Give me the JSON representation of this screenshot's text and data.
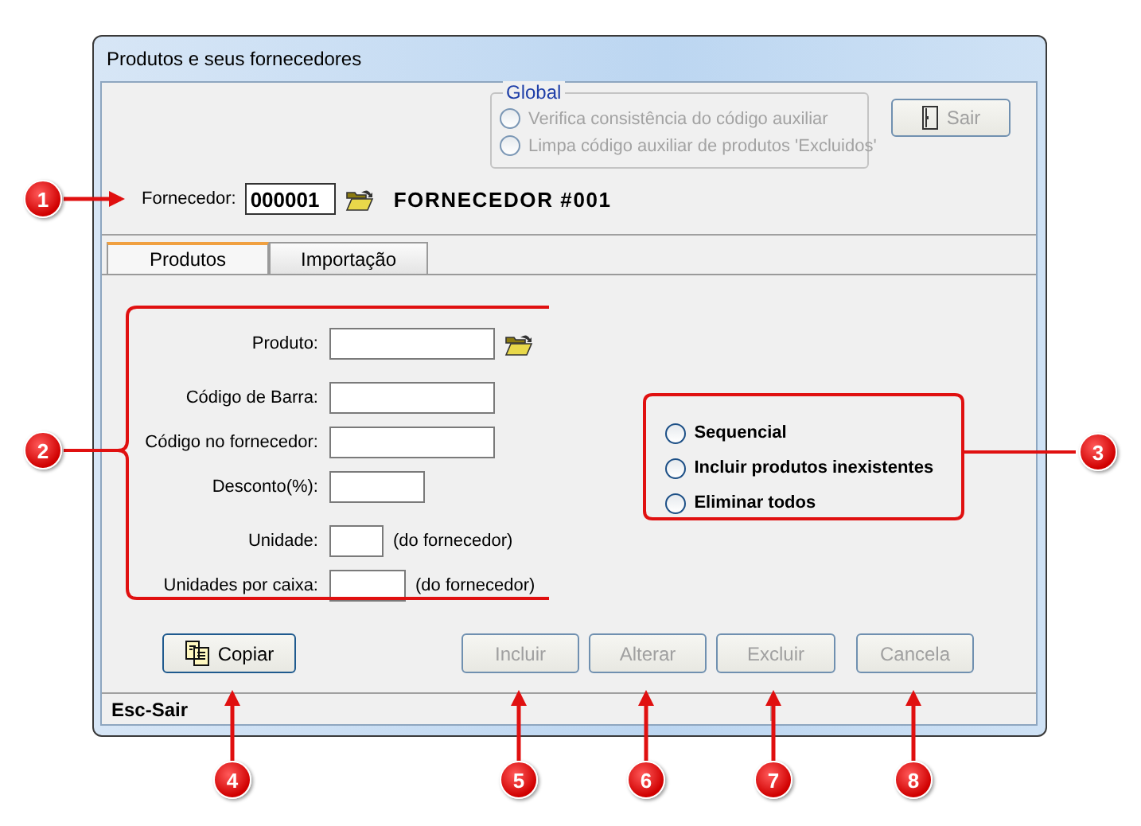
{
  "window": {
    "title": "Produtos e seus fornecedores"
  },
  "global_group": {
    "title": "Global",
    "options": [
      {
        "label": "Verifica consistência do código auxiliar",
        "selected": false,
        "disabled": true
      },
      {
        "label": "Limpa código auxiliar de produtos 'Excluidos'",
        "selected": false,
        "disabled": true
      }
    ]
  },
  "exit_button": {
    "label": "Sair",
    "disabled": true
  },
  "supplier": {
    "label": "Fornecedor:",
    "code": "000001",
    "name": "FORNECEDOR #001"
  },
  "tabs": [
    {
      "label": "Produtos",
      "selected": true
    },
    {
      "label": "Importação",
      "selected": false
    }
  ],
  "fields": [
    {
      "label": "Produto:",
      "kind": "lookup"
    },
    {
      "label": "Código de Barra:",
      "kind": "text"
    },
    {
      "label": "Código no fornecedor:",
      "kind": "text"
    },
    {
      "label": "Desconto(%):",
      "kind": "text"
    },
    {
      "label": "Unidade:",
      "kind": "text",
      "note": "(do fornecedor)"
    },
    {
      "label": "Unidades por caixa:",
      "kind": "text",
      "note": "(do fornecedor)"
    }
  ],
  "import_options": [
    {
      "label": "Sequencial",
      "selected": false
    },
    {
      "label": "Incluir produtos inexistentes",
      "selected": false
    },
    {
      "label": "Eliminar todos",
      "selected": false
    }
  ],
  "buttons": [
    {
      "label": "Copiar",
      "kind": "copy",
      "disabled": false
    },
    {
      "label": "Incluir",
      "kind": "plain",
      "disabled": true
    },
    {
      "label": "Alterar",
      "kind": "plain",
      "disabled": true
    },
    {
      "label": "Excluir",
      "kind": "plain",
      "disabled": true
    },
    {
      "label": "Cancela",
      "kind": "plain",
      "disabled": true
    }
  ],
  "status_bar": {
    "text": "Esc-Sair"
  },
  "callouts": [
    "1",
    "2",
    "3",
    "4",
    "5",
    "6",
    "7",
    "8"
  ]
}
